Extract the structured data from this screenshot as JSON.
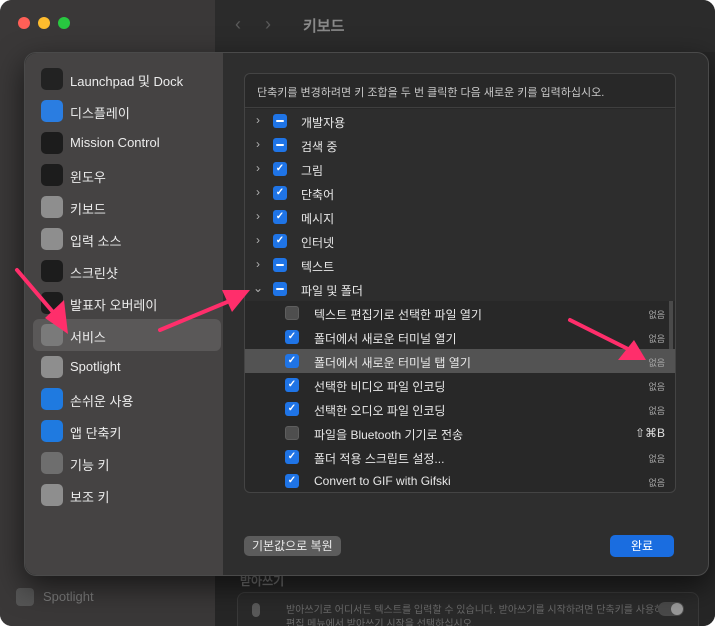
{
  "window": {
    "title": "키보드"
  },
  "dialog": {
    "info": "단축키를 변경하려면 키 조합을 두 번 클릭한 다음 새로운 키를 입력하십시오.",
    "sidebar": [
      {
        "label": "Launchpad 및 Dock",
        "icon": "launchpad-icon",
        "color": "#222222"
      },
      {
        "label": "디스플레이",
        "icon": "display-icon",
        "color": "#2a7de1"
      },
      {
        "label": "Mission Control",
        "icon": "mission-control-icon",
        "color": "#1c1c1c"
      },
      {
        "label": "윈도우",
        "icon": "window-icon",
        "color": "#1c1c1c"
      },
      {
        "label": "키보드",
        "icon": "keyboard-icon",
        "color": "#8e8e8e"
      },
      {
        "label": "입력 소스",
        "icon": "input-source-icon",
        "color": "#8e8e8e"
      },
      {
        "label": "스크린샷",
        "icon": "screenshot-icon",
        "color": "#1c1c1c"
      },
      {
        "label": "발표자 오버레이",
        "icon": "presenter-overlay-icon",
        "color": "#1c1c1c"
      },
      {
        "label": "서비스",
        "icon": "services-icon",
        "color": "#7a7a7a",
        "active": true
      },
      {
        "label": "Spotlight",
        "icon": "spotlight-icon",
        "color": "#8e8e8e"
      },
      {
        "label": "손쉬운 사용",
        "icon": "accessibility-icon",
        "color": "#1f7ae0"
      },
      {
        "label": "앱 단축키",
        "icon": "app-shortcuts-icon",
        "color": "#1f7ae0"
      },
      {
        "label": "기능 키",
        "icon": "fn-key-icon",
        "color": "#6e6e6e"
      },
      {
        "label": "보조 키",
        "icon": "modifier-key-icon",
        "color": "#8e8e8e"
      }
    ],
    "rows": [
      {
        "label": "개발자용",
        "type": "group",
        "state": "mixed",
        "chevron": "right"
      },
      {
        "label": "검색 중",
        "type": "group",
        "state": "mixed",
        "chevron": "right"
      },
      {
        "label": "그림",
        "type": "group",
        "state": "checked",
        "chevron": "right"
      },
      {
        "label": "단축어",
        "type": "group",
        "state": "checked",
        "chevron": "right"
      },
      {
        "label": "메시지",
        "type": "group",
        "state": "checked",
        "chevron": "right"
      },
      {
        "label": "인터넷",
        "type": "group",
        "state": "checked",
        "chevron": "right"
      },
      {
        "label": "텍스트",
        "type": "group",
        "state": "mixed",
        "chevron": "right"
      },
      {
        "label": "파일 및 폴더",
        "type": "group",
        "state": "mixed",
        "chevron": "down"
      },
      {
        "label": "텍스트 편집기로 선택한 파일 열기",
        "type": "item",
        "state": "unchecked",
        "shortcut": "없음"
      },
      {
        "label": "폴더에서 새로운 터미널 열기",
        "type": "item",
        "state": "checked",
        "shortcut": "없음"
      },
      {
        "label": "폴더에서 새로운 터미널 탭 열기",
        "type": "item",
        "state": "checked",
        "shortcut": "없음",
        "highlight": true
      },
      {
        "label": "선택한 비디오 파일 인코딩",
        "type": "item",
        "state": "checked",
        "shortcut": "없음"
      },
      {
        "label": "선택한 오디오 파일 인코딩",
        "type": "item",
        "state": "checked",
        "shortcut": "없음"
      },
      {
        "label": "파일을 Bluetooth 기기로 전송",
        "type": "item",
        "state": "unchecked",
        "shortcut": "⇧⌘B",
        "strong": true
      },
      {
        "label": "폴더 적용 스크립트 설정...",
        "type": "item",
        "state": "checked",
        "shortcut": "없음"
      },
      {
        "label": "Convert to GIF with Gifski",
        "type": "item",
        "state": "checked",
        "shortcut": "없음"
      }
    ],
    "buttons": {
      "restore": "기본값으로 복원",
      "done": "완료"
    }
  },
  "background": {
    "dictation_heading": "받아쓰기",
    "dictation_desc1": "받아쓰기로 어디서든 텍스트를 입력할 수 있습니다. 받아쓰기를 시작하려면 단축키를 사용하거나",
    "dictation_desc2": "편집 메뉴에서 받아쓰기 시작을 선택하십시오.",
    "sidebar_spotlight": "Spotlight"
  },
  "colors": {
    "accent": "#1f74e6",
    "annotation_arrow": "#ff2e6b"
  }
}
